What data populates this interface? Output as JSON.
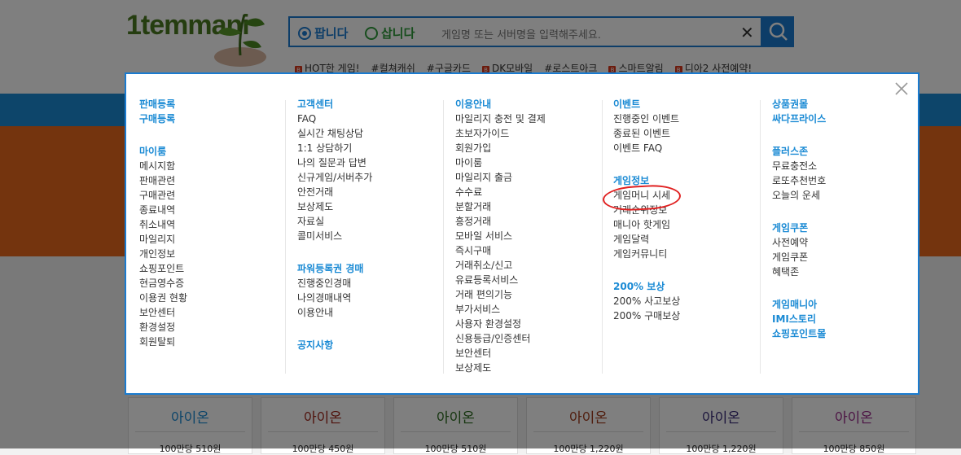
{
  "header": {
    "logo_text": "1temmani",
    "search": {
      "radio_sell": "팝니다",
      "radio_buy": "삽니다",
      "placeholder": "게임명 또는 서버명을 입력해주세요."
    },
    "hot_links": [
      "HOT한 게임!",
      "#컬쳐캐쉬",
      "#구글카드",
      "DK모바일",
      "#로스트아크",
      "스마트알림",
      "디아2 사전예약!"
    ]
  },
  "cards": [
    {
      "title": "아이온",
      "price": "100만당 510원",
      "color": "#1a8ad4"
    },
    {
      "title": "아이온",
      "price": "100만당 450원",
      "color": "#a0261b"
    },
    {
      "title": "아이온",
      "price": "100만당 510원",
      "color": "#2a6a1e"
    },
    {
      "title": "아이온",
      "price": "100만당 1,220원",
      "color": "#a03a1b"
    },
    {
      "title": "아이온",
      "price": "100만당 1,220원",
      "color": "#3a2d7a"
    },
    {
      "title": "아이온",
      "price": "100만당 850원",
      "color": "#9a2a8a"
    }
  ],
  "menu": {
    "col1": {
      "top": [
        "판매등록",
        "구매등록"
      ],
      "myroom_head": "마이룸",
      "myroom": [
        "메시지함",
        "판매관련",
        "구매관련",
        "종료내역",
        "취소내역",
        "마일리지",
        "개인정보",
        "쇼핑포인트",
        "현금영수증",
        "이용권 현황",
        "보안센터",
        "환경설정",
        "회원탈퇴"
      ]
    },
    "col2": {
      "head": "고객센터",
      "items": [
        "FAQ",
        "실시간 채팅상담",
        "1:1 상담하기",
        "나의 질문과 답변",
        "신규게임/서버추가",
        "안전거래",
        "보상제도",
        "자료실",
        "콜미서비스"
      ],
      "auction_head": "파워등록권 경매",
      "auction": [
        "진행중인경매",
        "나의경매내역",
        "이용안내"
      ],
      "notice_head": "공지사항"
    },
    "col3": {
      "head": "이용안내",
      "items": [
        "마일리지 충전 및 결제",
        "초보자가이드",
        "회원가입",
        "마이룸",
        "마일리지 출금",
        "수수료",
        "분할거래",
        "흥정거래",
        "모바일 서비스",
        "즉시구매",
        "거래취소/신고",
        "유료등록서비스",
        "거래 편의기능",
        "부가서비스",
        "사용자 환경설정",
        "신용등급/인증센터",
        "보안센터",
        "보상제도"
      ]
    },
    "col4": {
      "event_head": "이벤트",
      "events": [
        "진행중인 이벤트",
        "종료된 이벤트",
        "이벤트 FAQ"
      ],
      "gameinfo_head": "게임정보",
      "gameinfo": [
        "게임머니 시세",
        "거래순위정보",
        "매니아 핫게임",
        "게임달력",
        "게임커뮤니티"
      ],
      "comp_head": "200% 보상",
      "comp": [
        "200% 사고보상",
        "200% 구매보상"
      ]
    },
    "col5": {
      "gift_head": "상품권몰",
      "sale_head": "싸다프라이스",
      "plus_head": "플러스존",
      "plus": [
        "무료충전소",
        "로또추천번호",
        "오늘의 운세"
      ],
      "coupon_head": "게임쿠폰",
      "coupon": [
        "사전예약",
        "게임쿠폰",
        "혜택존"
      ],
      "mania_head": "게임매니아",
      "imi_head": "IMI스토리",
      "shop_head": "쇼핑포인트몰"
    }
  },
  "highlight_color": "#e02020",
  "accent_color": "#1a8ad4"
}
